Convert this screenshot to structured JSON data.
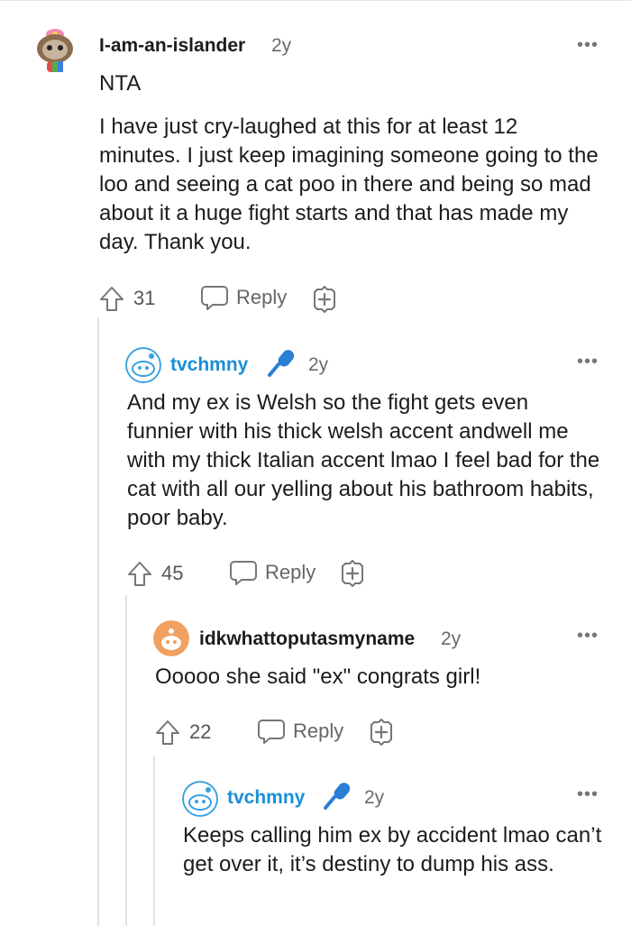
{
  "comments": [
    {
      "username": "I-am-an-islander",
      "age": "2y",
      "body": [
        "NTA",
        "I have just cry-laughed at this for at least 12 minutes. I just keep imagining someone going to the loo and seeing a cat poo in there and being so mad about it a huge fight starts and that has made my day. Thank you."
      ],
      "votes": "31",
      "reply_label": "Reply",
      "more": "•••"
    },
    {
      "username": "tvchmny",
      "age": "2y",
      "body": "And my ex is Welsh so the fight gets even funnier with his thick welsh accent andwell me with my thick Italian accent lmao I feel bad for the cat with all our yelling about his bathroom habits, poor baby.",
      "votes": "45",
      "reply_label": "Reply",
      "more": "•••"
    },
    {
      "username": "idkwhattoputasmyname",
      "age": "2y",
      "body": "Ooooo she said \"ex\" congrats girl!",
      "votes": "22",
      "reply_label": "Reply",
      "more": "•••"
    },
    {
      "username": "tvchmny",
      "age": "2y",
      "body": "Keeps calling him ex by accident lmao can’t get over it, it’s destiny to dump his ass.",
      "more": "•••"
    }
  ],
  "colors": {
    "op_badge": "#1a8fd6",
    "mic": "#2a7fd4",
    "thread_line": "#e3e3e3"
  }
}
